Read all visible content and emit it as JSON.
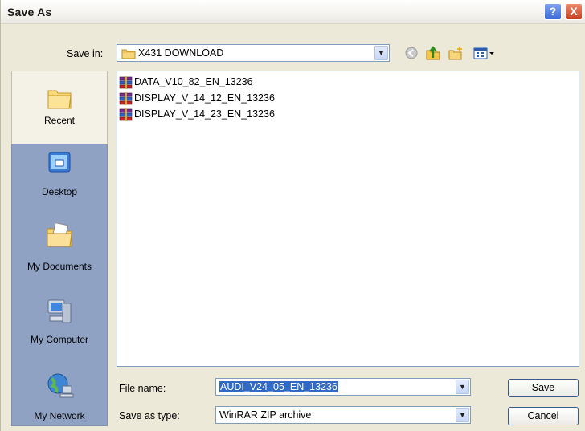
{
  "window": {
    "title": "Save As",
    "help_label": "?",
    "close_label": "X"
  },
  "toolbar": {
    "save_in_label": "Save in:",
    "save_in_value": "X431 DOWNLOAD",
    "icons": [
      "back-icon",
      "up-folder-icon",
      "new-folder-icon",
      "views-menu-icon"
    ]
  },
  "places": [
    {
      "label": "Recent",
      "icon": "recent-folder-icon",
      "selected": true
    },
    {
      "label": "Desktop",
      "icon": "desktop-icon",
      "selected": false
    },
    {
      "label": "My Documents",
      "icon": "my-documents-icon",
      "selected": false
    },
    {
      "label": "My Computer",
      "icon": "my-computer-icon",
      "selected": false
    },
    {
      "label": "My Network",
      "icon": "my-network-icon",
      "selected": false
    }
  ],
  "files": [
    {
      "name": "DATA_V10_82_EN_13236",
      "icon": "winrar-archive-icon"
    },
    {
      "name": "DISPLAY_V_14_12_EN_13236",
      "icon": "winrar-archive-icon"
    },
    {
      "name": "DISPLAY_V_14_23_EN_13236",
      "icon": "winrar-archive-icon"
    }
  ],
  "form": {
    "file_name_label": "File name:",
    "file_name_value": "AUDI_V24_05_EN_13236",
    "save_type_label": "Save as type:",
    "save_type_value": "WinRAR ZIP archive"
  },
  "buttons": {
    "save": "Save",
    "cancel": "Cancel"
  },
  "colors": {
    "places_bar": "#8fa2c3",
    "selection": "#316ac5",
    "dialog_bg": "#ece9d8"
  }
}
